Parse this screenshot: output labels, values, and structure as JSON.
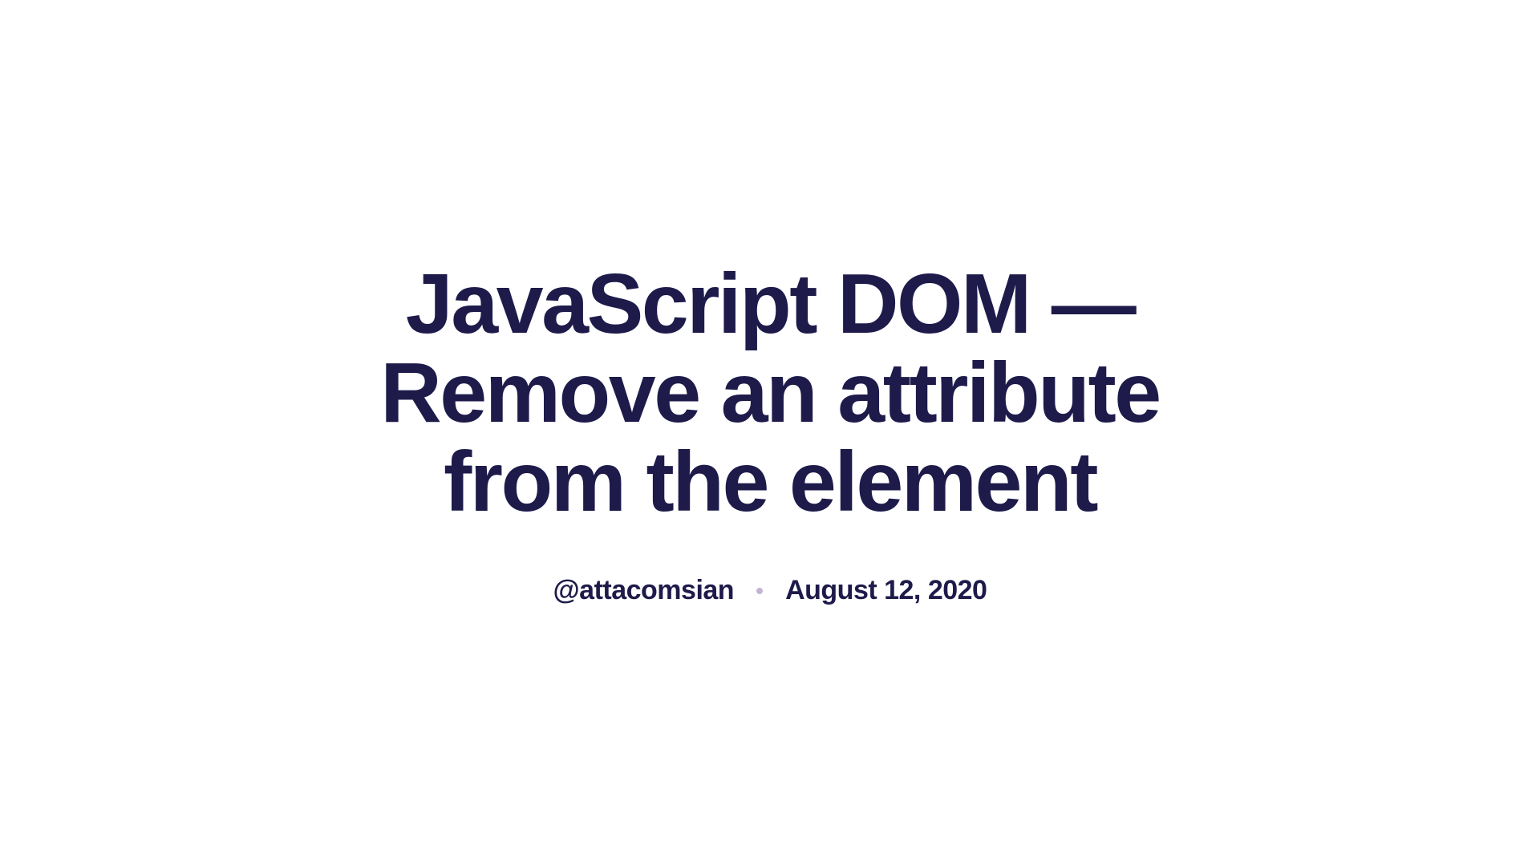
{
  "article": {
    "title": "JavaScript DOM — Remove an attribute from the element",
    "author": "@attacomsian",
    "date": "August 12, 2020"
  }
}
